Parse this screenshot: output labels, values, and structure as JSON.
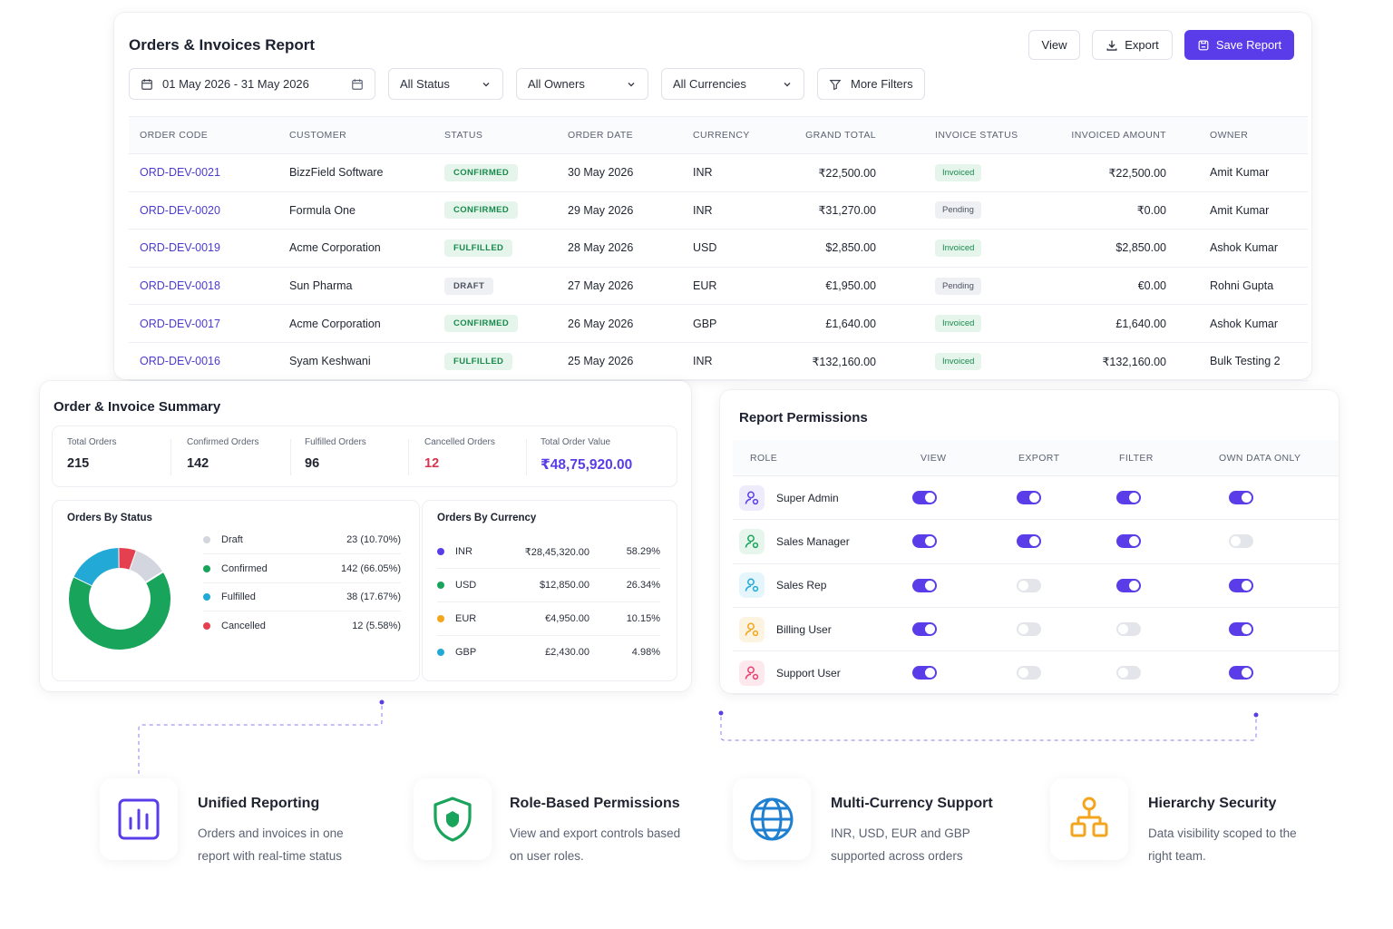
{
  "report": {
    "title": "Orders & Invoices Report",
    "buttons": {
      "view": "View",
      "export": "Export",
      "save": "Save Report"
    },
    "filters": {
      "date_range": "01 May 2026 - 31 May 2026",
      "status": "All Status",
      "owners": "All Owners",
      "currencies": "All Currencies",
      "more": "More Filters"
    },
    "columns": [
      "ORDER CODE",
      "CUSTOMER",
      "STATUS",
      "ORDER DATE",
      "CURRENCY",
      "GRAND TOTAL",
      "INVOICE STATUS",
      "INVOICED AMOUNT",
      "OWNER"
    ],
    "rows": [
      {
        "code": "ORD-DEV-0021",
        "customer": "BizzField Software",
        "status": "CONFIRMED",
        "status_kind": "confirmed",
        "date": "30 May 2026",
        "currency": "INR",
        "total": "₹22,500.00",
        "invoice_status": "Invoiced",
        "invoice_kind": "invoiced",
        "invoiced": "₹22,500.00",
        "owner": "Amit Kumar"
      },
      {
        "code": "ORD-DEV-0020",
        "customer": "Formula One",
        "status": "CONFIRMED",
        "status_kind": "confirmed",
        "date": "29 May 2026",
        "currency": "INR",
        "total": "₹31,270.00",
        "invoice_status": "Pending",
        "invoice_kind": "pending",
        "invoiced": "₹0.00",
        "owner": "Amit Kumar"
      },
      {
        "code": "ORD-DEV-0019",
        "customer": "Acme Corporation",
        "status": "FULFILLED",
        "status_kind": "fulfilled",
        "date": "28 May 2026",
        "currency": "USD",
        "total": "$2,850.00",
        "invoice_status": "Invoiced",
        "invoice_kind": "invoiced",
        "invoiced": "$2,850.00",
        "owner": "Ashok Kumar"
      },
      {
        "code": "ORD-DEV-0018",
        "customer": "Sun Pharma",
        "status": "DRAFT",
        "status_kind": "draft",
        "date": "27 May 2026",
        "currency": "EUR",
        "total": "€1,950.00",
        "invoice_status": "Pending",
        "invoice_kind": "pending",
        "invoiced": "€0.00",
        "owner": "Rohni Gupta"
      },
      {
        "code": "ORD-DEV-0017",
        "customer": "Acme Corporation",
        "status": "CONFIRMED",
        "status_kind": "confirmed",
        "date": "26 May 2026",
        "currency": "GBP",
        "total": "£1,640.00",
        "invoice_status": "Invoiced",
        "invoice_kind": "invoiced",
        "invoiced": "£1,640.00",
        "owner": "Ashok Kumar"
      },
      {
        "code": "ORD-DEV-0016",
        "customer": "Syam Keshwani",
        "status": "FULFILLED",
        "status_kind": "fulfilled",
        "date": "25 May 2026",
        "currency": "INR",
        "total": "₹132,160.00",
        "invoice_status": "Invoiced",
        "invoice_kind": "invoiced",
        "invoiced": "₹132,160.00",
        "owner": "Bulk Testing 2"
      }
    ]
  },
  "summary": {
    "title": "Order & Invoice Summary",
    "kpis": [
      {
        "label": "Total Orders",
        "value": "215"
      },
      {
        "label": "Confirmed Orders",
        "value": "142"
      },
      {
        "label": "Fulfilled Orders",
        "value": "96"
      },
      {
        "label": "Cancelled Orders",
        "value": "12"
      },
      {
        "label": "Total Order Value",
        "value": "₹48,75,920.00"
      }
    ],
    "by_status": {
      "title": "Orders By Status",
      "items": [
        {
          "label": "Draft",
          "value": "23 (10.70%)",
          "count": 23,
          "color": "#d3d6de"
        },
        {
          "label": "Confirmed",
          "value": "142 (66.05%)",
          "count": 142,
          "color": "#19a45b"
        },
        {
          "label": "Fulfilled",
          "value": "38 (17.67%)",
          "count": 38,
          "color": "#22a9d6"
        },
        {
          "label": "Cancelled",
          "value": "12 (5.58%)",
          "count": 12,
          "color": "#e5404f"
        }
      ]
    },
    "by_currency": {
      "title": "Orders By Currency",
      "items": [
        {
          "label": "INR",
          "amount": "₹28,45,320.00",
          "pct": "58.29%",
          "color": "#5a3de8"
        },
        {
          "label": "USD",
          "amount": "$12,850.00",
          "pct": "26.34%",
          "color": "#19a45b"
        },
        {
          "label": "EUR",
          "amount": "€4,950.00",
          "pct": "10.15%",
          "color": "#f2a51d"
        },
        {
          "label": "GBP",
          "amount": "£2,430.00",
          "pct": "4.98%",
          "color": "#22a9d6"
        }
      ]
    }
  },
  "permissions": {
    "title": "Report Permissions",
    "columns": [
      "ROLE",
      "VIEW",
      "EXPORT",
      "FILTER",
      "OWN DATA ONLY"
    ],
    "roles": [
      {
        "name": "Super Admin",
        "icon_color": "#5a3de8",
        "icon_bg": "#eeebfc",
        "view": true,
        "export": true,
        "filter": true,
        "own": true
      },
      {
        "name": "Sales Manager",
        "icon_color": "#19a45b",
        "icon_bg": "#e6f6ed",
        "view": true,
        "export": true,
        "filter": true,
        "own": false
      },
      {
        "name": "Sales Rep",
        "icon_color": "#22a9d6",
        "icon_bg": "#e4f5fb",
        "view": true,
        "export": false,
        "filter": true,
        "own": true
      },
      {
        "name": "Billing User",
        "icon_color": "#f2a51d",
        "icon_bg": "#fdf3e1",
        "view": true,
        "export": false,
        "filter": false,
        "own": true
      },
      {
        "name": "Support User",
        "icon_color": "#e5406e",
        "icon_bg": "#fde8ee",
        "view": true,
        "export": false,
        "filter": false,
        "own": true
      }
    ]
  },
  "features": [
    {
      "icon": "bar-chart-icon",
      "title": "Unified Reporting",
      "desc": "Orders and invoices in one report with real-time status"
    },
    {
      "icon": "shield-icon",
      "title": "Role-Based Permissions",
      "desc": "View and export controls based on user roles."
    },
    {
      "icon": "globe-icon",
      "title": "Multi-Currency Support",
      "desc": "INR, USD, EUR and GBP supported across orders"
    },
    {
      "icon": "hierarchy-icon",
      "title": "Hierarchy Security",
      "desc": "Data visibility scoped to the right team."
    }
  ]
}
